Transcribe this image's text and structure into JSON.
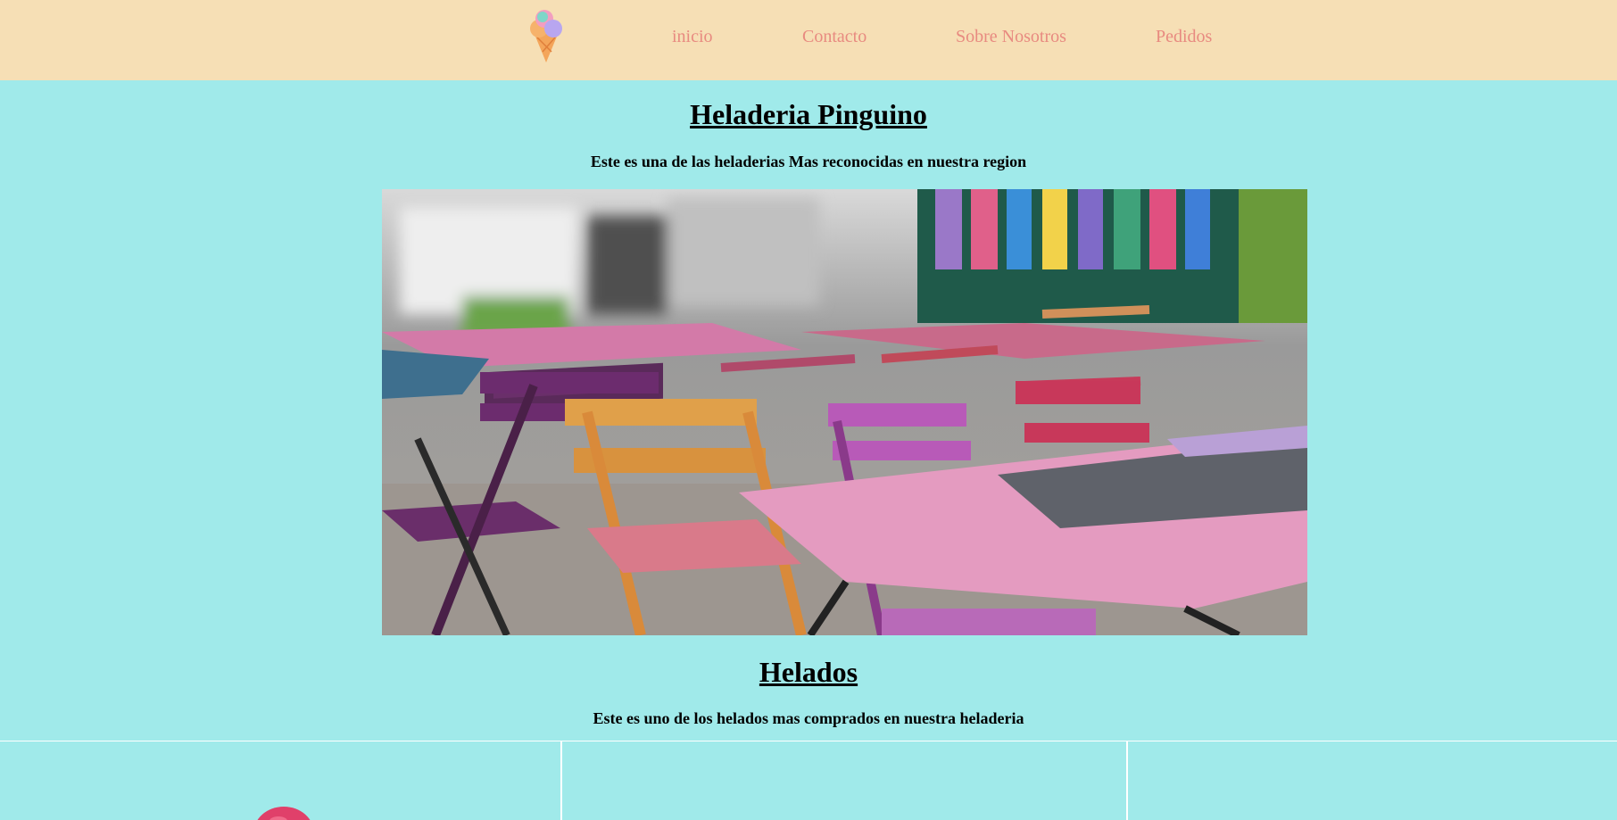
{
  "nav": {
    "logo": "ice-cream-cone-logo",
    "items": [
      {
        "label": "inicio"
      },
      {
        "label": "Contacto"
      },
      {
        "label": "Sobre Nosotros"
      },
      {
        "label": "Pedidos"
      }
    ]
  },
  "hero": {
    "title": "Heladeria Pinguino",
    "subtitle": "Este es una de las heladerias Mas reconocidas en nuestra region",
    "image": "outdoor-cafe-colorful-chairs-photo"
  },
  "helados": {
    "title": "Helados",
    "subtitle": "Este es uno de los helados mas comprados en nuestra heladeria"
  },
  "colors": {
    "background": "#a0eaea",
    "header": "#f6dfb5",
    "nav_text": "#e88a80"
  }
}
